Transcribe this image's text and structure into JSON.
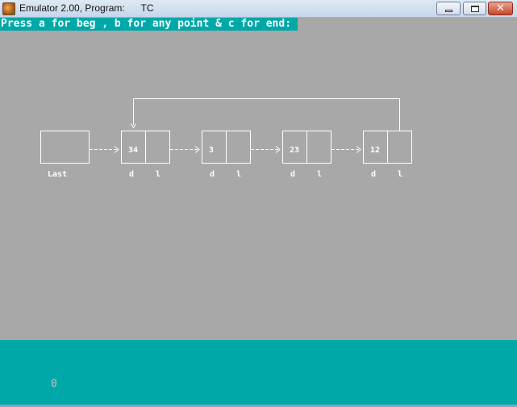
{
  "window": {
    "title": "Emulator 2.00, Program:      TC",
    "icon": "emulator-app-icon",
    "controls": {
      "minimize": "minimize-icon",
      "maximize": "maximize-icon",
      "close": "close-icon"
    }
  },
  "console": {
    "prompt": "Press a for beg , b for any point & c for end:",
    "colors": {
      "background": "#a8a8a8",
      "prompt_bg": "#00a8a8",
      "text": "#ffffff"
    }
  },
  "diagram": {
    "last_label": "Last",
    "field_labels": {
      "data": "d",
      "link": "l"
    },
    "nodes": [
      {
        "value": "34"
      },
      {
        "value": "3"
      },
      {
        "value": "23"
      },
      {
        "value": "12"
      }
    ]
  },
  "status_panel": {
    "value": "0",
    "color": "#00a8a8"
  }
}
